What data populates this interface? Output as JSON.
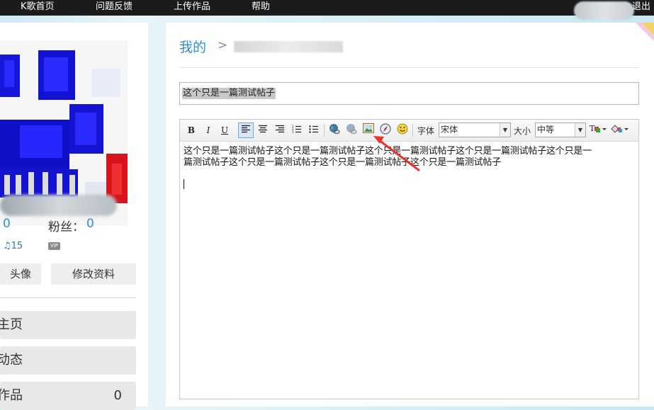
{
  "topnav": {
    "items": [
      "K歌首页",
      "问题反馈",
      "上传作品",
      "帮助"
    ],
    "logout": "退出"
  },
  "sidebar": {
    "stats": {
      "left_value": "0",
      "fans_label": "粉丝：",
      "fans_value": "0"
    },
    "vip_badge": "VIP",
    "music_badge": "♫15",
    "buttons": {
      "avatar": "头像",
      "edit_profile": "修改资料"
    },
    "nav": [
      {
        "label": "主页"
      },
      {
        "label": "动态"
      },
      {
        "label": "作品",
        "count": "0"
      }
    ]
  },
  "main": {
    "breadcrumb": {
      "root": "我的",
      "separator": ">"
    },
    "title_value": "这个只是一篇测试帖子",
    "editor": {
      "toolbar": {
        "bold": "B",
        "italic": "I",
        "underline": "U",
        "font_label": "字体",
        "font_value": "宋体",
        "size_label": "大小",
        "size_value": "中等"
      },
      "content_line1": "这个只是一篇测试帖子这个只是一篇测试帖子这个只是一篇测试帖子这个只是一篇测试帖子这个只是一",
      "content_line2": "篇测试帖子这个只是一篇测试帖子这个只是一篇测试帖子这个只是一篇测试帖子"
    }
  },
  "colors": {
    "accent": "#2f8fd1",
    "nav_bg": "#1b1b1b",
    "annotation_arrow": "#e8342c"
  }
}
